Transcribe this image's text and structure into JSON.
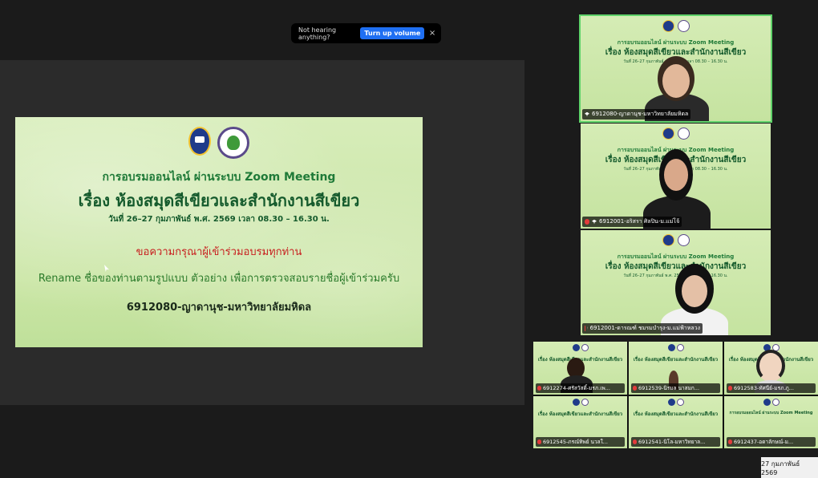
{
  "notice": {
    "text": "Not hearing anything?",
    "button": "Turn up volume",
    "close": "×"
  },
  "slide": {
    "line1": "การอบรมออนไลน์ ผ่านระบบ Zoom Meeting",
    "line2": "เรื่อง ห้องสมุดสีเขียวและสำนักงานสีเขียว",
    "line3": "วันที่ 26–27 กุมภาพันธ์ พ.ศ. 2569 เวลา 08.30 – 16.30 น.",
    "line4": "ขอความกรุณาผู้เข้าร่วมอบรมทุกท่าน",
    "line5": "Rename ชื่อของท่านตามรูปแบบ ตัวอย่าง เพื่อการตรวจสอบรายชื่อผู้เข้าร่วมครับ",
    "line6": "6912080-ญาดานุช-มหาวิทยาลัยมหิดล"
  },
  "video_tiles": [
    {
      "name": "6912080-ญาดานุช-มหาวิทยาลัยมหิดล"
    },
    {
      "name": "6912001-อริสรา ศิลปิน-ม.แม่โจ้"
    },
    {
      "name": "6912001-ดารณฑ์ ชมรมบำรุง-ม.แม่ฟ้าหลวง"
    }
  ],
  "grid_tiles": [
    {
      "name": "6912274-ศรัสวัสดิ์-มรภ.เพ..."
    },
    {
      "name": "6912539-นิรมล นาสมก..."
    },
    {
      "name": "6912583-ทัศนีย์-มรภ.ภู..."
    },
    {
      "name": "6912545-ภรณ์ทิพย์ นวลใ..."
    },
    {
      "name": "6912541-นิโล-มหาวิทยาล..."
    },
    {
      "name": "6912437-อดาลักษณ์-ม..."
    }
  ],
  "slide_mini": {
    "title": "การอบรมออนไลน์ ผ่านระบบ Zoom Meeting",
    "subtitle": "เรื่อง ห้องสมุดสีเขียวและสำนักงานสีเขียว",
    "date": "วันที่ 26–27 กุมภาพันธ์ พ.ศ. 2569 เวลา 08.30 – 16.30 น."
  },
  "taskbar_date": "27 กุมภาพันธ์ 2569"
}
